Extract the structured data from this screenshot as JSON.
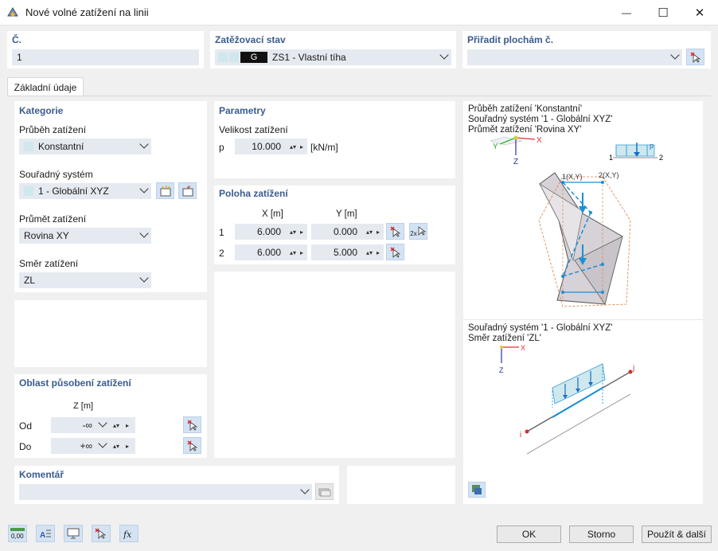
{
  "window": {
    "title": "Nové volné zatížení na linii",
    "minimize": "—",
    "maximize": "☐",
    "close": "✕"
  },
  "header": {
    "number_label": "Č.",
    "number_value": "1",
    "load_case_label": "Zatěžovací stav",
    "load_case_tag": "G",
    "load_case_value": "ZS1 - Vlastní tíha",
    "assign_label": "Přiřadit plochám č.",
    "assign_value": ""
  },
  "tabs": [
    {
      "label": "Základní údaje"
    }
  ],
  "category": {
    "title": "Kategorie",
    "distribution_label": "Průběh zatížení",
    "distribution_value": "Konstantní",
    "coord_label": "Souřadný systém",
    "coord_value": "1 - Globální XYZ",
    "projection_label": "Průmět zatížení",
    "projection_value": "Rovina XY",
    "direction_label": "Směr zatížení",
    "direction_value": "ZL"
  },
  "parameters": {
    "title": "Parametry",
    "magnitude_label": "Velikost zatížení",
    "p_label": "p",
    "p_value": "10.000",
    "p_unit": "[kN/m]"
  },
  "position": {
    "title": "Poloha zatížení",
    "col_x": "X [m]",
    "col_y": "Y [m]",
    "rows": [
      {
        "index": "1",
        "x": "6.000",
        "y": "0.000"
      },
      {
        "index": "2",
        "x": "6.000",
        "y": "5.000"
      }
    ],
    "repeat_label": "2x"
  },
  "area": {
    "title": "Oblast působení zatížení",
    "col_z": "Z [m]",
    "from_label": "Od",
    "from_value": "-∞",
    "to_label": "Do",
    "to_value": "+∞"
  },
  "comment": {
    "title": "Komentář",
    "value": ""
  },
  "preview": {
    "line1": "Průběh zatížení 'Konstantní'",
    "line2": "Souřadný systém '1 - Globální XYZ'",
    "line3": "Průmět zatížení 'Rovina XY'",
    "line4": "Souřadný systém '1 - Globální XYZ'",
    "line5": "Směr zatížení 'ZL'",
    "axis_x": "X",
    "axis_y": "Y",
    "axis_z": "Z",
    "pt1": "1",
    "pt2": "2",
    "p": "p",
    "label_xy1": "1(X,Y)",
    "label_xy2": "2(X,Y)",
    "node_i": "i",
    "node_j": "j"
  },
  "footer": {
    "ok": "OK",
    "cancel": "Storno",
    "apply_next": "Použít & další"
  }
}
